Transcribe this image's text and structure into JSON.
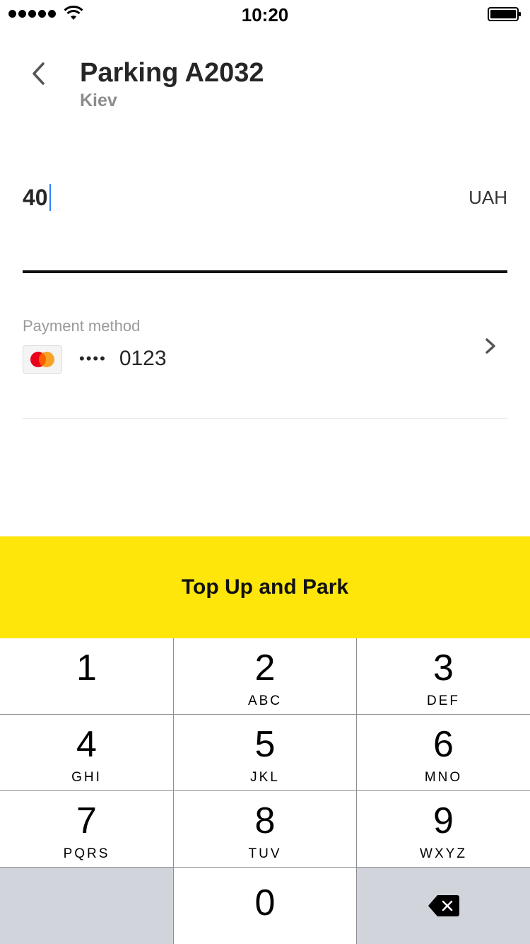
{
  "status_bar": {
    "time": "10:20"
  },
  "header": {
    "title": "Parking A2032",
    "subtitle": "Kiev"
  },
  "amount": {
    "value": "40",
    "currency": "UAH"
  },
  "payment": {
    "label": "Payment method",
    "card_dots": "••••",
    "card_last4": "0123",
    "card_brand_icon": "mastercard-icon"
  },
  "action": {
    "label": "Top Up and Park",
    "color": "#FFE60A"
  },
  "keypad": {
    "keys": [
      {
        "digit": "1",
        "letters": ""
      },
      {
        "digit": "2",
        "letters": "ABC"
      },
      {
        "digit": "3",
        "letters": "DEF"
      },
      {
        "digit": "4",
        "letters": "GHI"
      },
      {
        "digit": "5",
        "letters": "JKL"
      },
      {
        "digit": "6",
        "letters": "MNO"
      },
      {
        "digit": "7",
        "letters": "PQRS"
      },
      {
        "digit": "8",
        "letters": "TUV"
      },
      {
        "digit": "9",
        "letters": "WXYZ"
      },
      {
        "digit": "0",
        "letters": ""
      }
    ],
    "backspace_icon": "backspace-icon"
  }
}
